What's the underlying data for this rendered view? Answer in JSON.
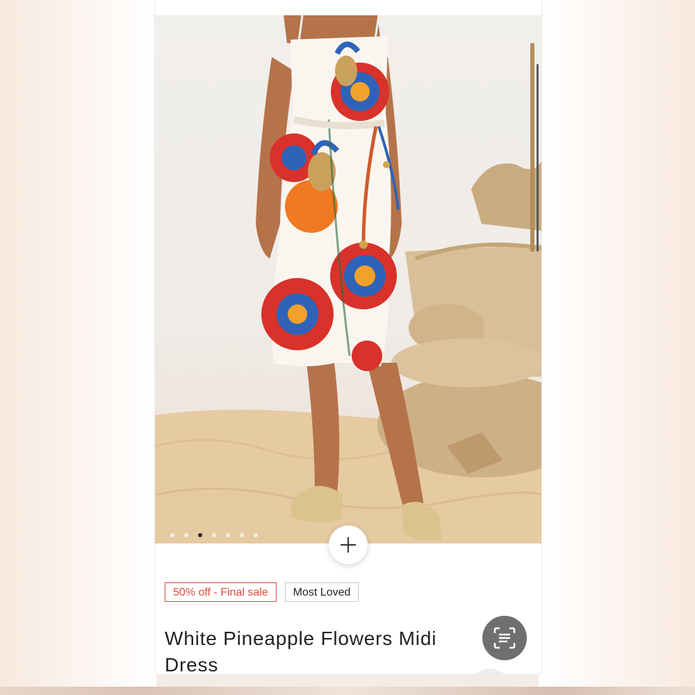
{
  "product": {
    "image_alt": "Woman wearing white midi dress with large red, orange and blue floral and pineapple print on sandy beach set",
    "carousel": {
      "total": 7,
      "active_index": 2
    },
    "badges": {
      "sale": "50% off - Final sale",
      "loved": "Most Loved"
    },
    "title": "White Pineapple Flowers Midi Dress"
  },
  "icons": {
    "zoom": "plus-icon",
    "scan": "scan-text-icon"
  },
  "colors": {
    "sale_accent": "#e2483f",
    "scan_button": "#6f6f6f"
  }
}
